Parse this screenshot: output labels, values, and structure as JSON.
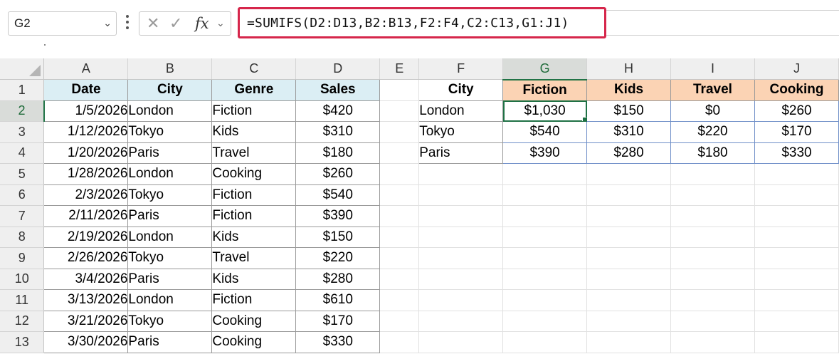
{
  "name_box": {
    "value": "G2"
  },
  "formula_bar": {
    "cancel_icon": "close-icon",
    "enter_icon": "check-icon",
    "fx_label": "fx",
    "formula": "=SUMIFS(D2:D13,B2:B13,F2:F4,C2:C13,G1:J1)"
  },
  "columns": [
    "A",
    "B",
    "C",
    "D",
    "E",
    "F",
    "G",
    "H",
    "I",
    "J"
  ],
  "selected_column": "G",
  "selected_row": "2",
  "rows": [
    "1",
    "2",
    "3",
    "4",
    "5",
    "6",
    "7",
    "8",
    "9",
    "10",
    "11",
    "12",
    "13"
  ],
  "source_table": {
    "headers": [
      "Date",
      "City",
      "Genre",
      "Sales"
    ],
    "rows": [
      [
        "1/5/2026",
        "London",
        "Fiction",
        "$420"
      ],
      [
        "1/12/2026",
        "Tokyo",
        "Kids",
        "$310"
      ],
      [
        "1/20/2026",
        "Paris",
        "Travel",
        "$180"
      ],
      [
        "1/28/2026",
        "London",
        "Cooking",
        "$260"
      ],
      [
        "2/3/2026",
        "Tokyo",
        "Fiction",
        "$540"
      ],
      [
        "2/11/2026",
        "Paris",
        "Fiction",
        "$390"
      ],
      [
        "2/19/2026",
        "London",
        "Kids",
        "$150"
      ],
      [
        "2/26/2026",
        "Tokyo",
        "Travel",
        "$220"
      ],
      [
        "3/4/2026",
        "Paris",
        "Kids",
        "$280"
      ],
      [
        "3/13/2026",
        "London",
        "Fiction",
        "$610"
      ],
      [
        "3/21/2026",
        "Tokyo",
        "Cooking",
        "$170"
      ],
      [
        "3/30/2026",
        "Paris",
        "Cooking",
        "$330"
      ]
    ]
  },
  "summary_table": {
    "corner_header": "City",
    "genres": [
      "Fiction",
      "Kids",
      "Travel",
      "Cooking"
    ],
    "rows": [
      {
        "city": "London",
        "values": [
          "$1,030",
          "$150",
          "$0",
          "$260"
        ]
      },
      {
        "city": "Tokyo",
        "values": [
          "$540",
          "$310",
          "$220",
          "$170"
        ]
      },
      {
        "city": "Paris",
        "values": [
          "$390",
          "$280",
          "$180",
          "$330"
        ]
      }
    ]
  },
  "colors": {
    "formula_highlight": "#d6264b",
    "header_blue": "#dbeef4",
    "header_orange": "#fbd3b4",
    "selection_green": "#1f7145"
  }
}
